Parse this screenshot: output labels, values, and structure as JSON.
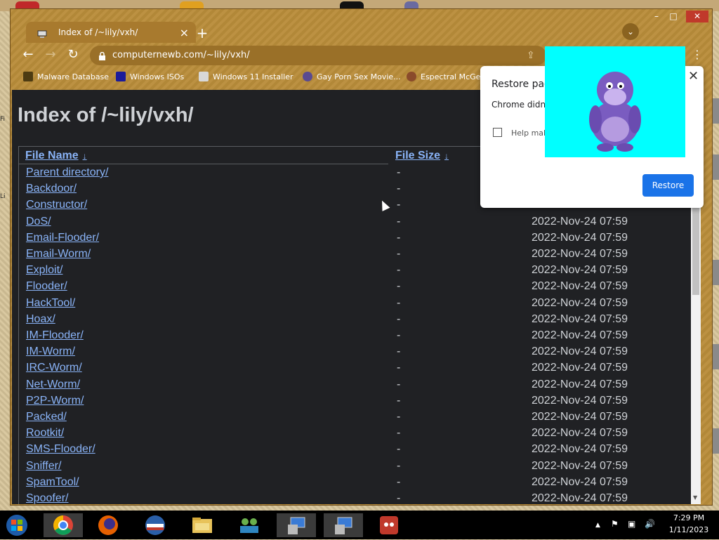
{
  "window": {
    "title": "Index of /~lily/vxh/"
  },
  "tab": {
    "title": "Index of /~lily/vxh/",
    "close": "×",
    "new_tab": "+"
  },
  "window_controls": {
    "minimize": "–",
    "maximize": "□",
    "close": "✕"
  },
  "tab_search": "⌄",
  "toolbar": {
    "back": "←",
    "forward": "→",
    "reload": "↻",
    "url": "computernewb.com/~lily/vxh/",
    "share": "⇪",
    "menu": "⋮"
  },
  "bookmarks": [
    {
      "label": "Malware Database",
      "color": "#4d3b12"
    },
    {
      "label": "Windows ISOs",
      "color": "#1b1b9a"
    },
    {
      "label": "Windows 11 Installer",
      "color": "#d8d8d8"
    },
    {
      "label": "Gay Porn Sex Movie...",
      "color": "#5a4a90"
    },
    {
      "label": "Espectral McGe",
      "color": "#8a4b2b"
    }
  ],
  "page": {
    "heading": "Index of /~lily/vxh/",
    "columns": {
      "name": "File Name",
      "size": "File Size",
      "sort_arrow": "↓"
    },
    "rows": [
      {
        "name": "Parent directory/",
        "size": "-",
        "date": ""
      },
      {
        "name": "Backdoor/",
        "size": "-",
        "date": ""
      },
      {
        "name": "Constructor/",
        "size": "-",
        "date": "2022-Nov-24 07:59"
      },
      {
        "name": "DoS/",
        "size": "-",
        "date": "2022-Nov-24 07:59"
      },
      {
        "name": "Email-Flooder/",
        "size": "-",
        "date": "2022-Nov-24 07:59"
      },
      {
        "name": "Email-Worm/",
        "size": "-",
        "date": "2022-Nov-24 07:59"
      },
      {
        "name": "Exploit/",
        "size": "-",
        "date": "2022-Nov-24 07:59"
      },
      {
        "name": "Flooder/",
        "size": "-",
        "date": "2022-Nov-24 07:59"
      },
      {
        "name": "HackTool/",
        "size": "-",
        "date": "2022-Nov-24 07:59"
      },
      {
        "name": "Hoax/",
        "size": "-",
        "date": "2022-Nov-24 07:59"
      },
      {
        "name": "IM-Flooder/",
        "size": "-",
        "date": "2022-Nov-24 07:59"
      },
      {
        "name": "IM-Worm/",
        "size": "-",
        "date": "2022-Nov-24 07:59"
      },
      {
        "name": "IRC-Worm/",
        "size": "-",
        "date": "2022-Nov-24 07:59"
      },
      {
        "name": "Net-Worm/",
        "size": "-",
        "date": "2022-Nov-24 07:59"
      },
      {
        "name": "P2P-Worm/",
        "size": "-",
        "date": "2022-Nov-24 07:59"
      },
      {
        "name": "Packed/",
        "size": "-",
        "date": "2022-Nov-24 07:59"
      },
      {
        "name": "Rootkit/",
        "size": "-",
        "date": "2022-Nov-24 07:59"
      },
      {
        "name": "SMS-Flooder/",
        "size": "-",
        "date": "2022-Nov-24 07:59"
      },
      {
        "name": "Sniffer/",
        "size": "-",
        "date": "2022-Nov-24 07:59"
      },
      {
        "name": "SpamTool/",
        "size": "-",
        "date": "2022-Nov-24 07:59"
      },
      {
        "name": "Spoofer/",
        "size": "-",
        "date": "2022-Nov-24 07:59"
      }
    ]
  },
  "popup": {
    "title": "Restore pag",
    "body": "Chrome didn'",
    "help": "Help mak crash rep",
    "close": "✕",
    "restore_label": "Restore"
  },
  "taskbar": {
    "items": [
      "start",
      "chrome",
      "firefox",
      "internet-explorer",
      "file-explorer",
      "network-users",
      "remote-desktop-1",
      "remote-desktop-2",
      "angry-birds"
    ],
    "tray": {
      "show_hidden": "▲",
      "flag": "⚑",
      "network": "▣",
      "volume": "🔊"
    },
    "clock": {
      "time": "7:29 PM",
      "date": "1/11/2023"
    }
  },
  "colors": {
    "link": "#8ab4f8",
    "page_bg": "#202124",
    "accent_blue": "#1a73e8",
    "chrome_theme": "#b98d3a",
    "bonzi_bg": "#00ffff"
  }
}
